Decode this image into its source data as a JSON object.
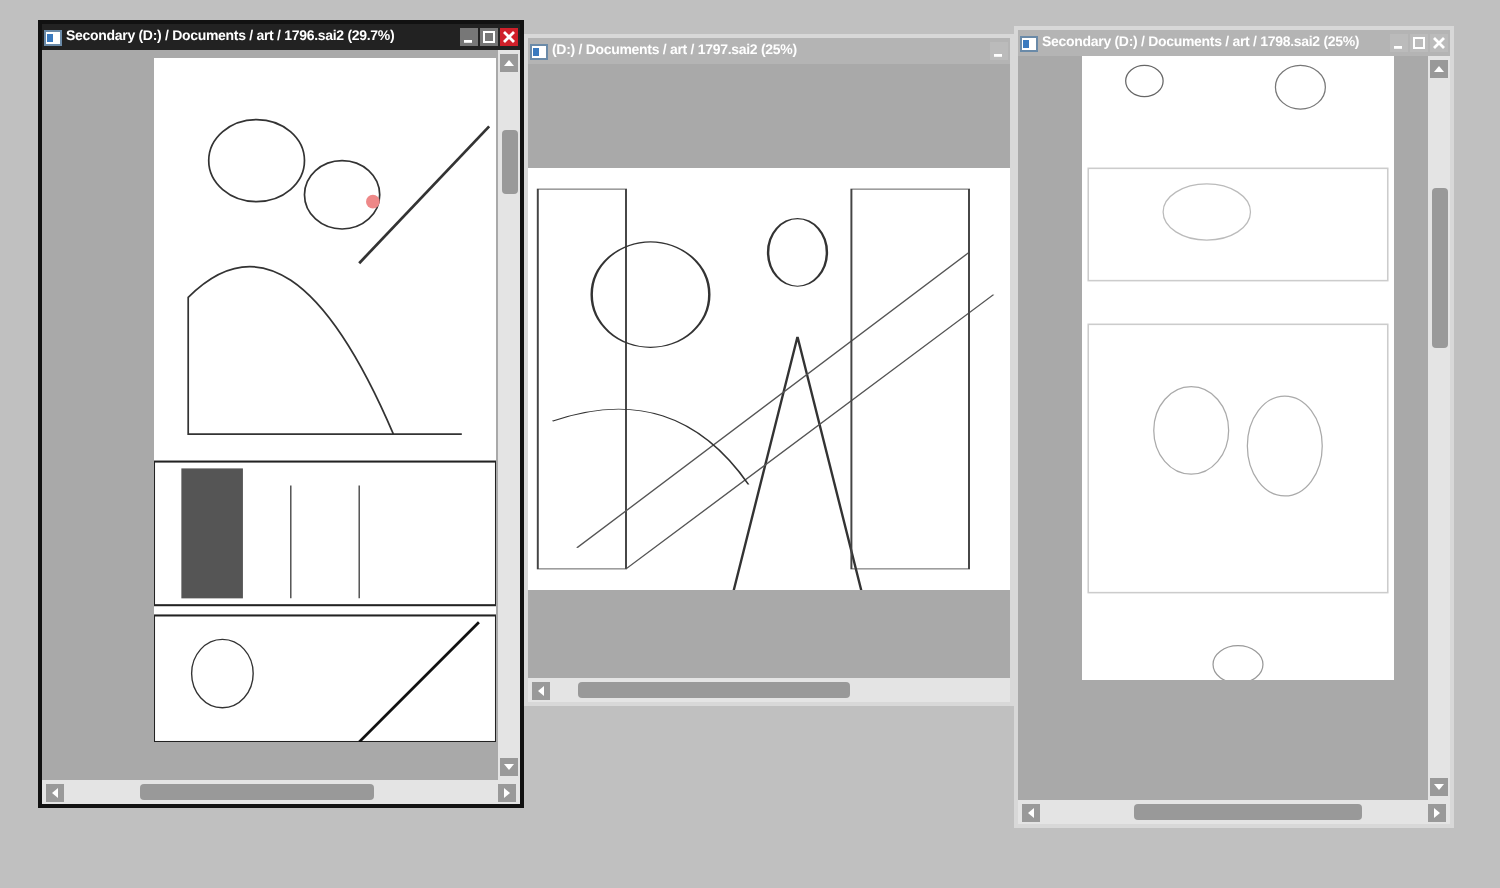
{
  "windows": [
    {
      "title": "Secondary (D:) / Documents / art / 1796.sai2 (29.7%)",
      "active": true,
      "controls": [
        {
          "kind": "minimize"
        },
        {
          "kind": "maximize"
        },
        {
          "kind": "close"
        }
      ],
      "kind": "picture"
    },
    {
      "title": "(D:) / Documents / art / 1797.sai2 (25%)",
      "active": false,
      "controls": [
        {
          "kind": "minimize"
        }
      ],
      "kind": "picture"
    },
    {
      "title": "Secondary (D:) / Documents / art / 1798.sai2 (25%)",
      "active": false,
      "controls": [
        {
          "kind": "minimize"
        },
        {
          "kind": "maximize"
        },
        {
          "kind": "close"
        }
      ],
      "kind": "picture"
    }
  ]
}
